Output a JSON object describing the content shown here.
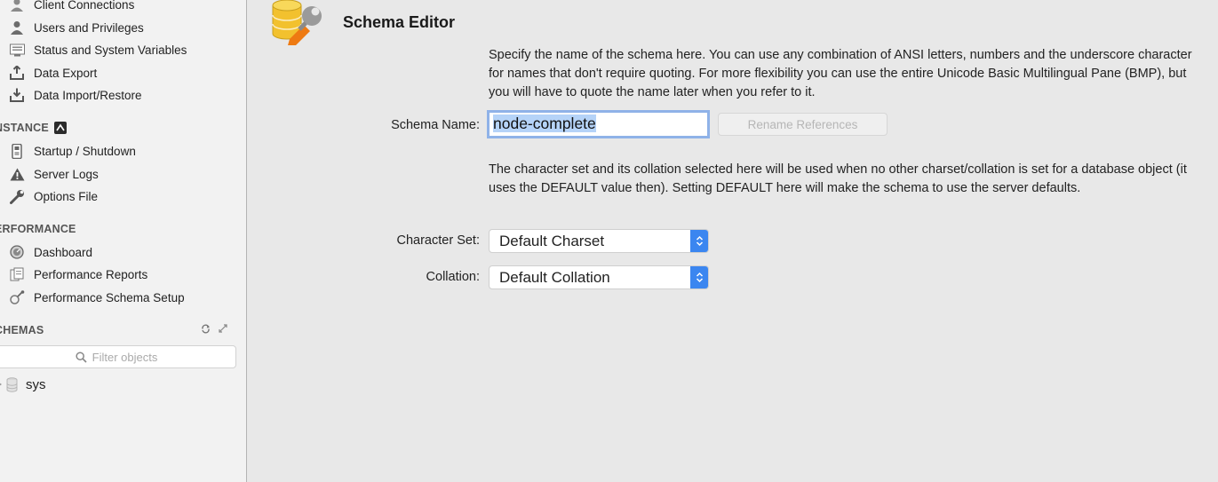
{
  "sidebar": {
    "items_top": [
      {
        "label": "Client Connections",
        "icon": "client-connections-icon"
      },
      {
        "label": "Users and Privileges",
        "icon": "user-icon"
      },
      {
        "label": "Status and System Variables",
        "icon": "status-variables-icon"
      },
      {
        "label": "Data Export",
        "icon": "data-export-icon"
      },
      {
        "label": "Data Import/Restore",
        "icon": "data-import-icon"
      }
    ],
    "instance": {
      "title": "NSTANCE",
      "items": [
        {
          "label": "Startup / Shutdown",
          "icon": "startup-shutdown-icon"
        },
        {
          "label": "Server Logs",
          "icon": "warning-icon"
        },
        {
          "label": "Options File",
          "icon": "wrench-icon"
        }
      ]
    },
    "performance": {
      "title": "ERFORMANCE",
      "items": [
        {
          "label": "Dashboard",
          "icon": "dashboard-icon"
        },
        {
          "label": "Performance Reports",
          "icon": "reports-icon"
        },
        {
          "label": "Performance Schema Setup",
          "icon": "schema-setup-icon"
        }
      ]
    },
    "schemas": {
      "title": "CHEMAS",
      "filter_placeholder": "Filter objects",
      "tree": [
        {
          "label": "sys"
        }
      ]
    }
  },
  "main": {
    "title": "Schema Editor",
    "name_description": "Specify the name of the schema here. You can use any combination of ANSI letters, numbers and the underscore character for names that don't require quoting. For more flexibility you can use the entire Unicode Basic Multilingual Pane (BMP), but you will have to quote the name later when you refer to it.",
    "schema_name_label": "Schema Name:",
    "schema_name_value": "node-complete",
    "rename_button": "Rename References",
    "charset_description": "The character set and its collation selected here will be used when no other charset/collation is set for a database object (it uses the DEFAULT value then). Setting DEFAULT here will make the schema to use the server defaults.",
    "charset_label": "Character Set:",
    "charset_value": "Default Charset",
    "collation_label": "Collation:",
    "collation_value": "Default Collation"
  },
  "colors": {
    "accent": "#3b86f0",
    "selection": "#b5d3f8",
    "focus_ring": "#8fb2e8"
  }
}
